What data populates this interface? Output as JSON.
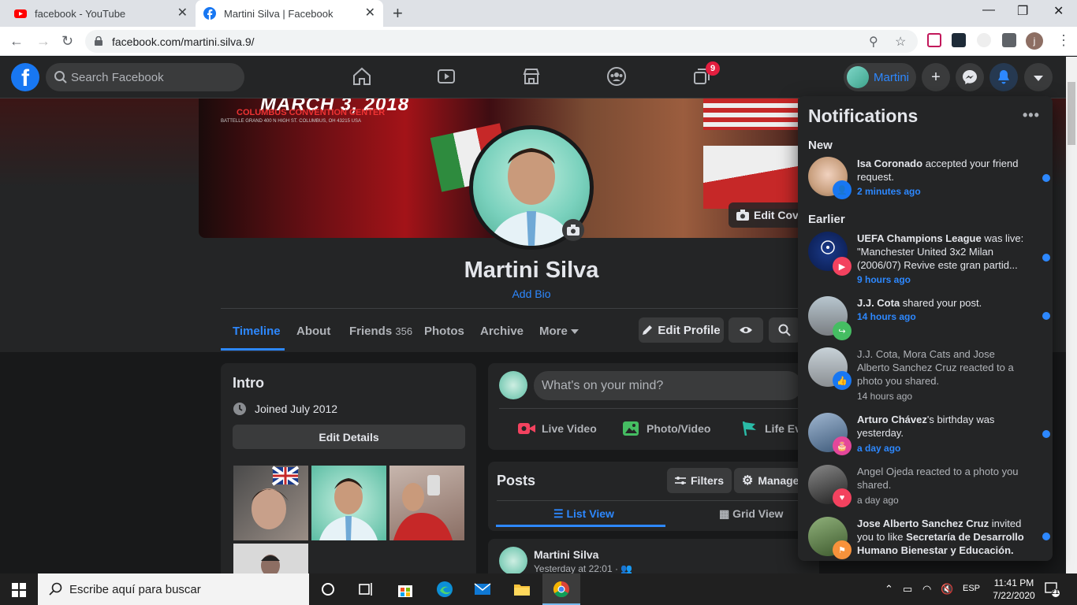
{
  "browser": {
    "tabs": [
      {
        "title": "facebook - YouTube"
      },
      {
        "title": "Martini Silva | Facebook"
      }
    ],
    "url": "facebook.com/martini.silva.9/",
    "profile_initial": "j"
  },
  "fb_header": {
    "search_placeholder": "Search Facebook",
    "groups_badge": "9",
    "profile_name": "Martini",
    "colors": {
      "accent": "#2d88ff",
      "brand": "#1877f2",
      "badge": "#e41e3f"
    }
  },
  "cover": {
    "banner_line1": "MARCH 3, 2018",
    "banner_line2": "COLUMBUS CONVENTION CENTER",
    "banner_line3": "BATTELLE GRAND 400 N HIGH ST. COLUMBUS, OH 43215 USA",
    "edit_cover_label": "Edit Cove"
  },
  "profile": {
    "name": "Martini Silva",
    "add_bio": "Add Bio",
    "tabs": [
      {
        "label": "Timeline"
      },
      {
        "label": "About"
      },
      {
        "label": "Friends",
        "count": "356"
      },
      {
        "label": "Photos"
      },
      {
        "label": "Archive"
      },
      {
        "label": "More"
      }
    ],
    "edit_profile": "Edit Profile"
  },
  "intro": {
    "title": "Intro",
    "joined": "Joined July 2012",
    "edit_details": "Edit Details"
  },
  "composer": {
    "placeholder": "What's on your mind?",
    "live_video": "Live Video",
    "photo_video": "Photo/Video",
    "life_event": "Life Eve"
  },
  "posts": {
    "title": "Posts",
    "filters": "Filters",
    "manage": "Manage",
    "list_view": "List View",
    "grid_view": "Grid View",
    "first_post": {
      "author": "Martini Silva",
      "time": "Yesterday at 22:01"
    }
  },
  "notifications": {
    "title": "Notifications",
    "section_new": "New",
    "section_earlier": "Earlier",
    "items": [
      {
        "actor": "Isa Coronado",
        "text": " accepted your friend request.",
        "time": "2 minutes ago",
        "unread": true
      },
      {
        "actor": "UEFA Champions League",
        "text": " was live: \"Manchester United 3x2 Milan (2006/07) Revive este gran partid...",
        "time": "9 hours ago",
        "unread": true
      },
      {
        "actor": "J.J. Cota",
        "text": " shared your post.",
        "time": "14 hours ago",
        "unread": true
      },
      {
        "actor": "",
        "text": "J.J. Cota, Mora Cats and Jose Alberto Sanchez Cruz reacted to a photo you shared.",
        "time": "14 hours ago",
        "unread": false
      },
      {
        "actor": "Arturo Chávez",
        "text": "'s birthday was yesterday.",
        "time": "a day ago",
        "unread": true
      },
      {
        "actor": "",
        "text": "Angel Ojeda reacted to a photo you shared.",
        "time": "a day ago",
        "unread": false
      },
      {
        "actor": "Jose Alberto Sanchez Cruz",
        "text": " invited you to like ",
        "object": "Secretaría de Desarrollo Humano Bienestar y Educación.",
        "unread": true
      }
    ]
  },
  "taskbar": {
    "search_placeholder": "Escribe aquí para buscar",
    "language": "ESP",
    "time": "11:41 PM",
    "date": "7/22/2020",
    "notification_count": "21"
  }
}
